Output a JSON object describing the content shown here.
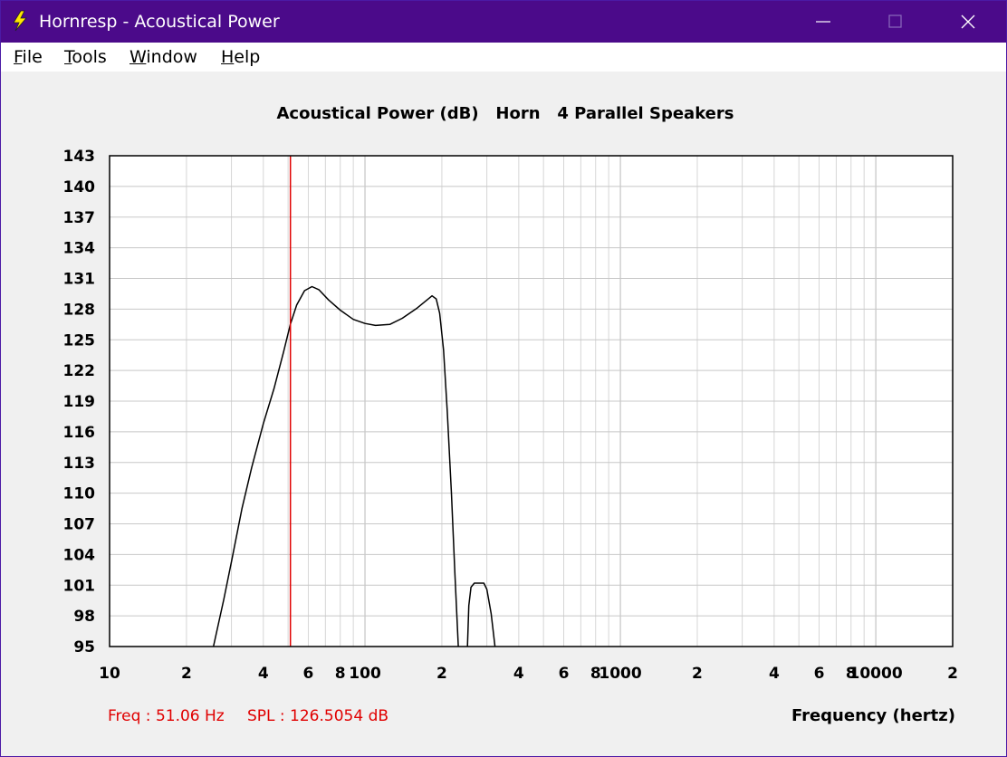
{
  "window": {
    "title": "Hornresp - Acoustical Power",
    "controls": [
      "minimize-icon",
      "maximize-icon",
      "close-icon"
    ],
    "accent_color": "#4b0a8a"
  },
  "menu": {
    "items": [
      {
        "label": "File",
        "mnemonic": "F"
      },
      {
        "label": "Tools",
        "mnemonic": "T"
      },
      {
        "label": "Window",
        "mnemonic": "W"
      },
      {
        "label": "Help",
        "mnemonic": "H"
      }
    ]
  },
  "status": {
    "freq": "Freq : 51.06 Hz",
    "spl": "SPL : 126.5054 dB",
    "color": "#e00000"
  },
  "chart_data": {
    "type": "line",
    "title": "Acoustical Power (dB)   Horn   4 Parallel Speakers",
    "xlabel": "Frequency (hertz)",
    "ylabel": "",
    "x_scale": "log",
    "xlim": [
      10,
      20000
    ],
    "ylim": [
      95,
      143
    ],
    "grid": true,
    "y_ticks": [
      "143",
      "140",
      "137",
      "134",
      "131",
      "128",
      "125",
      "122",
      "119",
      "116",
      "113",
      "110",
      "107",
      "104",
      "101",
      "98",
      "95"
    ],
    "x_tick_labels": [
      {
        "value": 10,
        "label": "10"
      },
      {
        "value": 20,
        "label": "2"
      },
      {
        "value": 40,
        "label": "4"
      },
      {
        "value": 60,
        "label": "6"
      },
      {
        "value": 80,
        "label": "8"
      },
      {
        "value": 100,
        "label": "100"
      },
      {
        "value": 200,
        "label": "2"
      },
      {
        "value": 400,
        "label": "4"
      },
      {
        "value": 600,
        "label": "6"
      },
      {
        "value": 800,
        "label": "8"
      },
      {
        "value": 1000,
        "label": "1000"
      },
      {
        "value": 2000,
        "label": "2"
      },
      {
        "value": 4000,
        "label": "4"
      },
      {
        "value": 6000,
        "label": "6"
      },
      {
        "value": 8000,
        "label": "8"
      },
      {
        "value": 10000,
        "label": "10000"
      },
      {
        "value": 20000,
        "label": "2"
      }
    ],
    "cursor": {
      "freq": 51.06,
      "color": "#e00000"
    },
    "series": [
      {
        "color": "#000000",
        "segments": [
          [
            [
              25.5,
              95
            ],
            [
              28,
              99.6
            ],
            [
              30,
              103.3
            ],
            [
              33,
              108.5
            ],
            [
              36,
              112.5
            ],
            [
              40,
              116.8
            ],
            [
              44,
              120.2
            ],
            [
              48,
              123.8
            ],
            [
              51,
              126.5
            ],
            [
              54,
              128.4
            ],
            [
              58,
              129.8
            ],
            [
              62,
              130.2
            ],
            [
              66,
              129.9
            ],
            [
              72,
              128.9
            ],
            [
              80,
              127.9
            ],
            [
              90,
              127.0
            ],
            [
              100,
              126.6
            ],
            [
              110,
              126.4
            ],
            [
              125,
              126.5
            ],
            [
              140,
              127.1
            ],
            [
              160,
              128.1
            ],
            [
              175,
              128.9
            ],
            [
              183,
              129.3
            ],
            [
              190,
              129.0
            ],
            [
              196,
              127.6
            ],
            [
              203,
              124.0
            ],
            [
              210,
              118.0
            ],
            [
              218,
              110.0
            ],
            [
              225,
              102.0
            ],
            [
              232,
              95
            ]
          ],
          [
            [
              252,
              95
            ],
            [
              255,
              99
            ],
            [
              260,
              100.8
            ],
            [
              268,
              101.2
            ],
            [
              280,
              101.2
            ],
            [
              292,
              101.2
            ],
            [
              300,
              100.6
            ],
            [
              312,
              98.2
            ],
            [
              323,
              95
            ]
          ]
        ]
      }
    ]
  }
}
